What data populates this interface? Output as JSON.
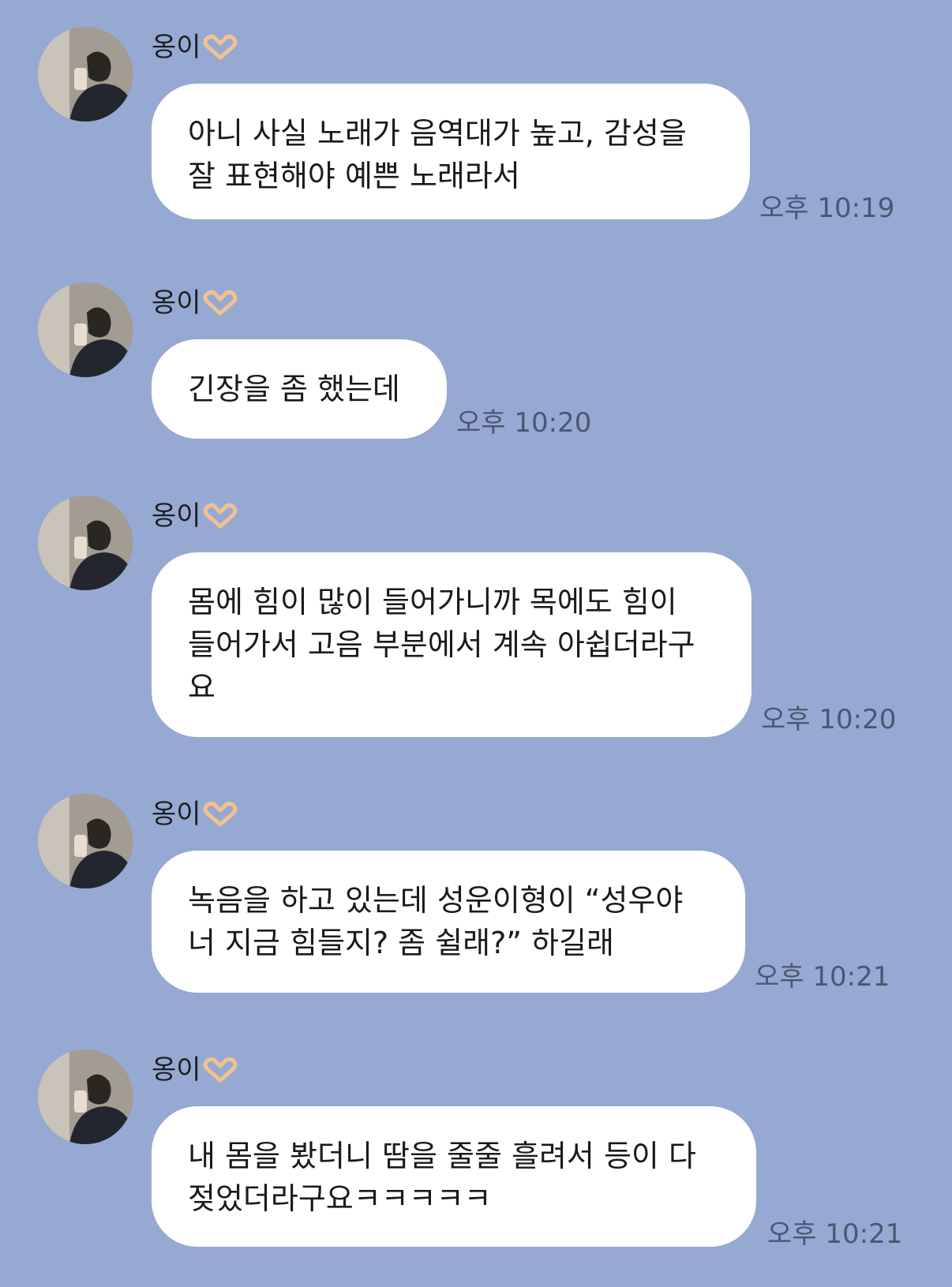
{
  "messages": [
    {
      "sender": "옹이",
      "emoji": "🫶",
      "text": "아니 사실 노래가 음역대가 높고, 감성을\n잘 표현해야 예쁜 노래라서",
      "time": "오후 10:19"
    },
    {
      "sender": "옹이",
      "emoji": "🫶",
      "text": "긴장을 좀 했는데",
      "time": "오후 10:20"
    },
    {
      "sender": "옹이",
      "emoji": "🫶",
      "text": "몸에 힘이 많이 들어가니까 목에도 힘이\n들어가서 고음 부분에서 계속 아쉽더라구\n요",
      "time": "오후 10:20"
    },
    {
      "sender": "옹이",
      "emoji": "🫶",
      "text": "녹음을 하고 있는데 성운이형이 “성우야\n너 지금 힘들지? 좀 쉴래?” 하길래",
      "time": "오후 10:21"
    },
    {
      "sender": "옹이",
      "emoji": "🫶",
      "text": "내 몸을 봤더니 땀을 줄줄 흘려서 등이 다\n젖었더라구요ㅋㅋㅋㅋㅋ",
      "time": "오후 10:21"
    }
  ],
  "colors": {
    "background": "#96a9d3",
    "bubble": "#ffffff",
    "time": "#4d5670"
  }
}
